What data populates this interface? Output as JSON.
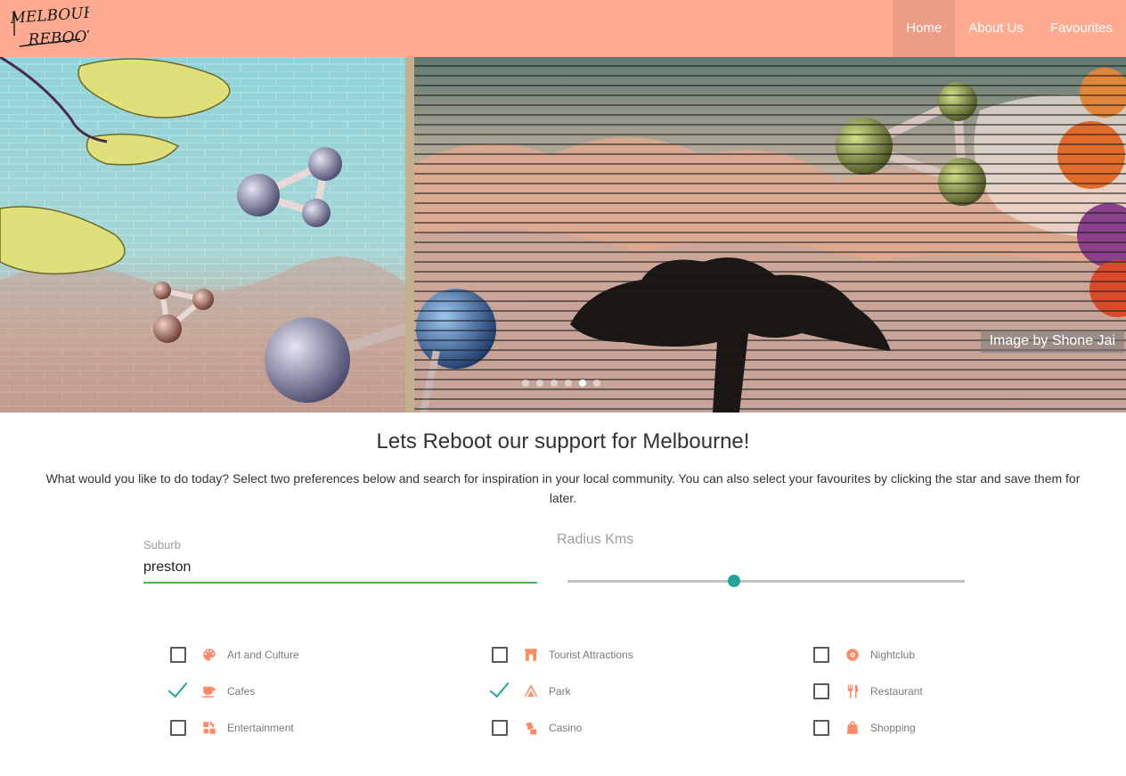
{
  "app": {
    "logo_text": "Melbourne Reboot",
    "accent_color": "#ffab91",
    "check_color": "#26a69a",
    "icon_color": "#ff8a65"
  },
  "nav": {
    "items": [
      {
        "label": "Home",
        "active": true
      },
      {
        "label": "About Us",
        "active": false
      },
      {
        "label": "Favourites",
        "active": false
      }
    ]
  },
  "hero": {
    "caption": "Image by Shone Jai",
    "slide_count": 6,
    "active_slide": 4
  },
  "main": {
    "headline": "Lets Reboot our support for Melbourne!",
    "intro": "What would you like to do today? Select two preferences below and search for inspiration in your local community. You can also select your favourites by clicking the star and save them for later."
  },
  "search": {
    "suburb_label": "Suburb",
    "suburb_value": "preston",
    "radius_label": "Radius Kms",
    "radius_fraction": 0.42
  },
  "preferences": [
    {
      "label": "Art and Culture",
      "icon": "palette-icon",
      "checked": false
    },
    {
      "label": "Tourist Attractions",
      "icon": "arch-icon",
      "checked": false
    },
    {
      "label": "Nightclub",
      "icon": "disc-icon",
      "checked": false
    },
    {
      "label": "Cafes",
      "icon": "coffee-cup-icon",
      "checked": true
    },
    {
      "label": "Park",
      "icon": "tent-icon",
      "checked": true
    },
    {
      "label": "Restaurant",
      "icon": "fork-knife-icon",
      "checked": false
    },
    {
      "label": "Entertainment",
      "icon": "toys-icon",
      "checked": false
    },
    {
      "label": "Casino",
      "icon": "dice-icon",
      "checked": false
    },
    {
      "label": "Shopping",
      "icon": "shopping-bag-icon",
      "checked": false
    }
  ]
}
